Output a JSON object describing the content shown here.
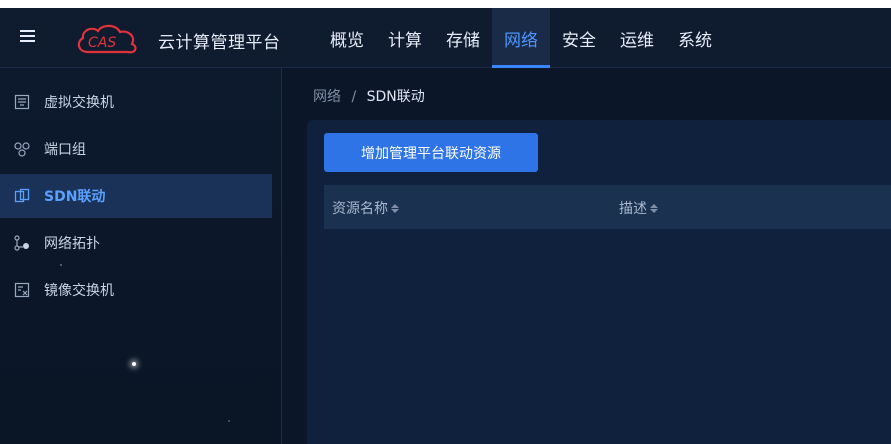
{
  "header": {
    "logo_text": "CAS",
    "app_title": "云计算管理平台",
    "nav": [
      {
        "label": "概览"
      },
      {
        "label": "计算"
      },
      {
        "label": "存储"
      },
      {
        "label": "网络",
        "active": true
      },
      {
        "label": "安全"
      },
      {
        "label": "运维"
      },
      {
        "label": "系统"
      }
    ]
  },
  "sidebar": {
    "items": [
      {
        "label": "虚拟交换机",
        "icon": "virtual-switch-icon"
      },
      {
        "label": "端口组",
        "icon": "port-group-icon"
      },
      {
        "label": "SDN联动",
        "icon": "sdn-link-icon",
        "active": true
      },
      {
        "label": "网络拓扑",
        "icon": "topology-icon"
      },
      {
        "label": "镜像交换机",
        "icon": "mirror-switch-icon"
      }
    ]
  },
  "breadcrumb": {
    "parent": "网络",
    "separator": "/",
    "current": "SDN联动"
  },
  "main": {
    "add_button_label": "增加管理平台联动资源",
    "table": {
      "columns": [
        {
          "label": "资源名称"
        },
        {
          "label": "描述"
        }
      ],
      "rows": []
    }
  },
  "colors": {
    "accent": "#3a86ff",
    "button": "#2f74e6",
    "sidebar_active": "#1b3258"
  }
}
